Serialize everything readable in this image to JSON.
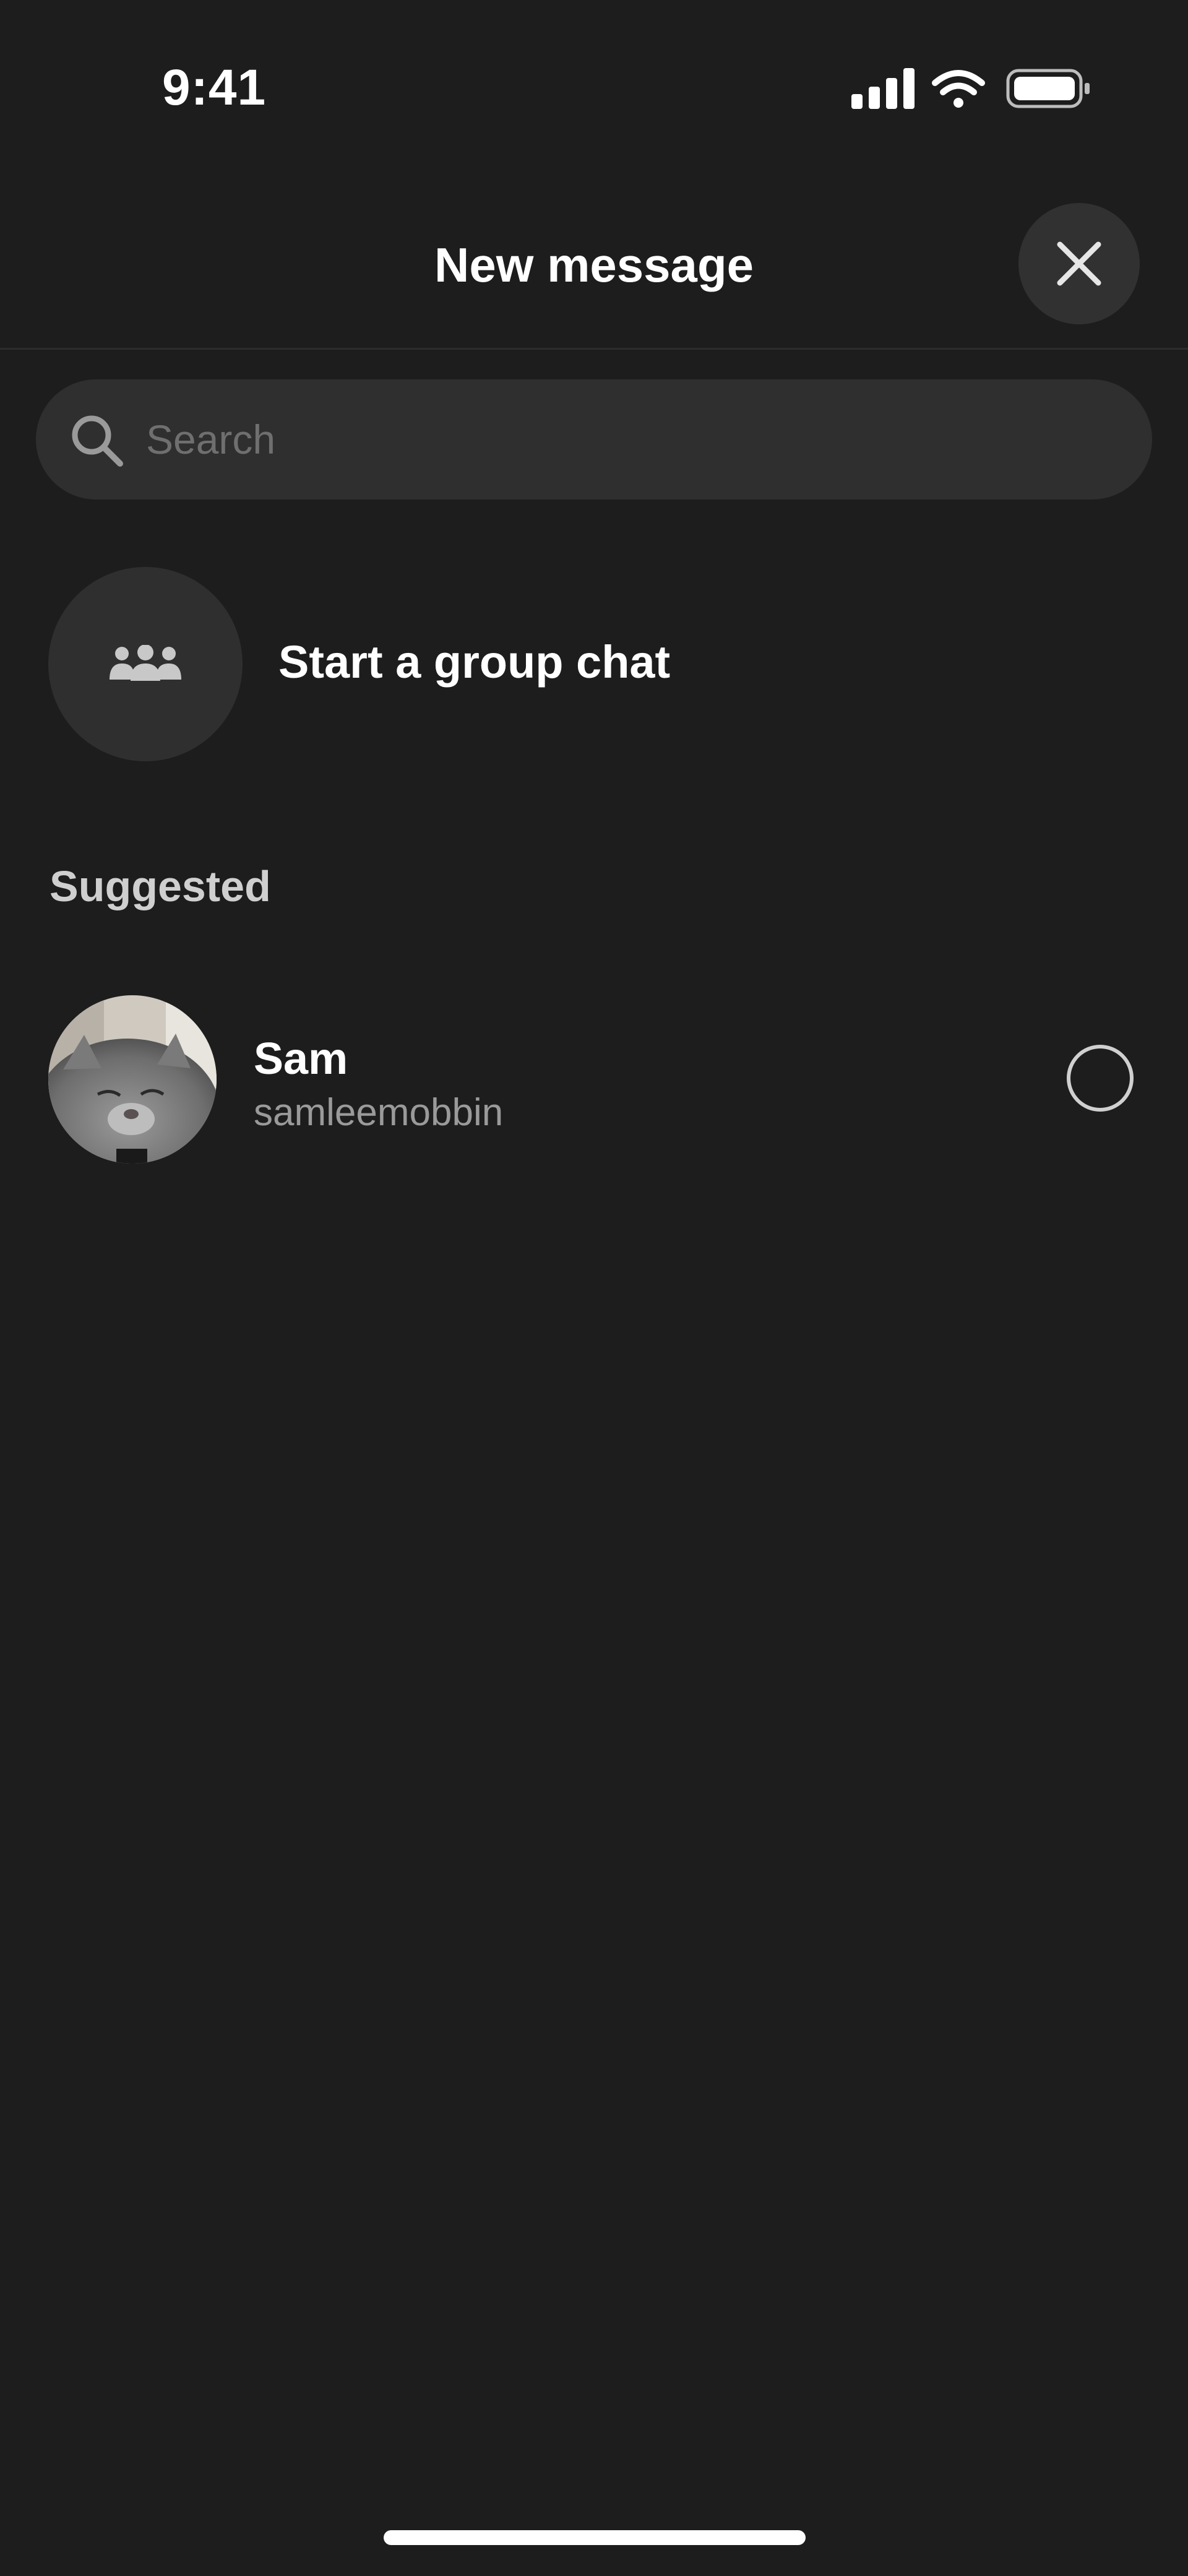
{
  "status_bar": {
    "time": "9:41",
    "icons": [
      "cellular-signal-icon",
      "wifi-icon",
      "battery-icon"
    ]
  },
  "header": {
    "title": "New message",
    "close_icon": "close-icon"
  },
  "search": {
    "placeholder": "Search",
    "value": "",
    "icon": "search-icon"
  },
  "group_chat": {
    "label": "Start a group chat",
    "icon": "group-people-icon"
  },
  "suggested": {
    "section_label": "Suggested",
    "contacts": [
      {
        "name": "Sam",
        "handle": "samleemobbin",
        "selected": false
      }
    ]
  },
  "colors": {
    "background": "#1d1d1d",
    "surface": "#2f2f2f",
    "text_primary": "#ffffff",
    "text_secondary": "#9a9a9a",
    "placeholder": "#6f6f6f"
  }
}
